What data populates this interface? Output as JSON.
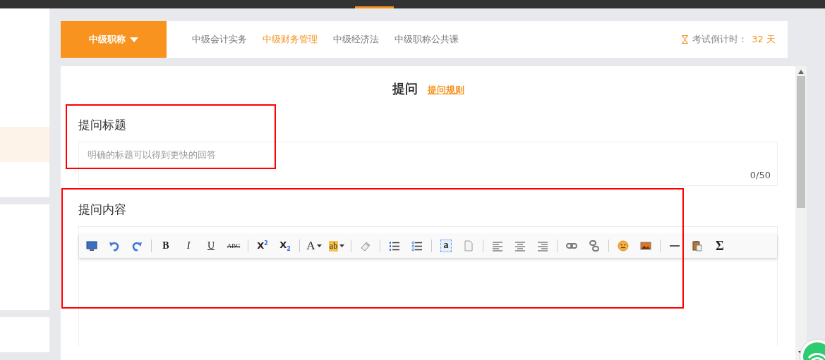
{
  "category_button": {
    "label": "中级职称"
  },
  "nav_tabs": [
    {
      "label": "中级会计实务",
      "selected": false
    },
    {
      "label": "中级财务管理",
      "selected": true
    },
    {
      "label": "中级经济法",
      "selected": false
    },
    {
      "label": "中级职称公共课",
      "selected": false
    }
  ],
  "countdown": {
    "label": "考试倒计时：",
    "value": "32",
    "unit": "天"
  },
  "page_title": "提问",
  "rules_link": "提问规则",
  "title_field": {
    "label": "提问标题",
    "placeholder": "明确的标题可以得到更快的回答",
    "counter": "0/50"
  },
  "content_field": {
    "label": "提问内容"
  },
  "toolbar": [
    [
      {
        "kind": "monitor"
      },
      {
        "kind": "undo"
      },
      {
        "kind": "redo"
      }
    ],
    [
      {
        "kind": "bold",
        "label": "B"
      },
      {
        "kind": "italic",
        "label": "I"
      },
      {
        "kind": "underline",
        "label": "U"
      },
      {
        "kind": "strikethrough",
        "label": "ABC"
      }
    ],
    [
      {
        "kind": "superscript",
        "label": "X$^{2}$"
      },
      {
        "kind": "subscript",
        "label": "X$_{2}$"
      }
    ],
    [
      {
        "kind": "fontcolor",
        "label": "A",
        "dropdown": true
      },
      {
        "kind": "highlight",
        "label": "ab",
        "dropdown": true
      }
    ],
    [
      {
        "kind": "eraser"
      }
    ],
    [
      {
        "kind": "orderedlist"
      },
      {
        "kind": "unorderedlist"
      }
    ],
    [
      {
        "kind": "textbox",
        "label": "a"
      },
      {
        "kind": "page"
      }
    ],
    [
      {
        "kind": "alignleft"
      },
      {
        "kind": "aligncenter"
      },
      {
        "kind": "alignright"
      }
    ],
    [
      {
        "kind": "link"
      },
      {
        "kind": "unlink"
      }
    ],
    [
      {
        "kind": "emoji"
      },
      {
        "kind": "image"
      }
    ],
    [
      {
        "kind": "rule"
      },
      {
        "kind": "paste"
      },
      {
        "kind": "formula",
        "label": "Σ"
      }
    ]
  ]
}
